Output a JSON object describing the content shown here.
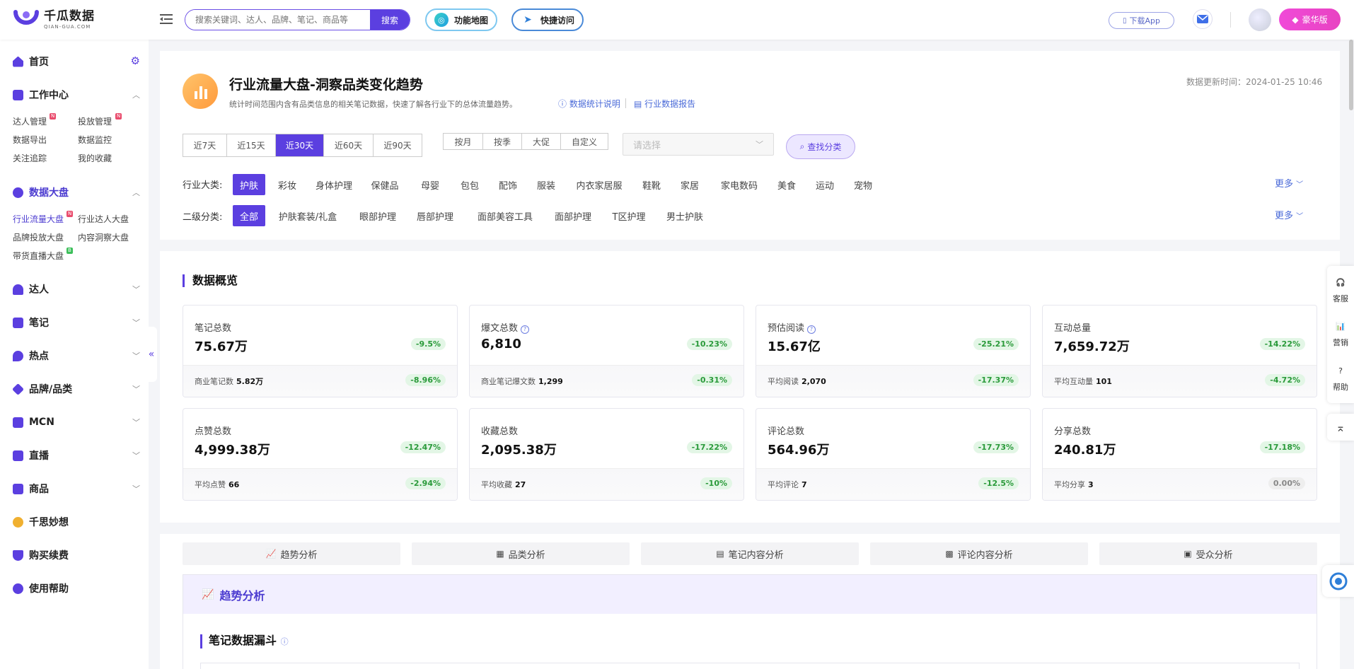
{
  "brand": {
    "name_cn": "千瓜数据",
    "name_en": "QIAN-GUA.COM",
    "accent": "#5b3fe0",
    "up_color": "#2a9a3a"
  },
  "header": {
    "search_placeholder": "搜索关键词、达人、品牌、笔记、商品等",
    "search_btn": "搜索",
    "feature_map": "功能地图",
    "quick_access": "快捷访问",
    "download_app": "下载App",
    "vip": "豪华版"
  },
  "sidebar": {
    "home": "首页",
    "workcenter": "工作中心",
    "work_items": [
      "达人管理",
      "投放管理",
      "数据导出",
      "数据监控",
      "关注追踪",
      "我的收藏"
    ],
    "databoard": "数据大盘",
    "board_items": [
      "行业流量大盘",
      "行业达人大盘",
      "品牌投放大盘",
      "内容洞察大盘",
      "带货直播大盘"
    ],
    "badge_new": "N",
    "badge_b": "B",
    "menus": [
      "达人",
      "笔记",
      "热点",
      "品牌/品类",
      "MCN",
      "直播",
      "商品",
      "千思妙想",
      "购买续费",
      "使用帮助"
    ]
  },
  "page": {
    "title": "行业流量大盘-洞察品类变化趋势",
    "subtitle": "统计时间范围内含有品类信息的相关笔记数据，快速了解各行业下的总体流量趋势。",
    "link_stats": "数据统计说明",
    "link_report": "行业数据报告",
    "update_time": "数据更新时间：2024-01-25 10:46"
  },
  "filters": {
    "ranges": [
      "近7天",
      "近15天",
      "近30天",
      "近60天",
      "近90天"
    ],
    "range_selected": "近30天",
    "periods": [
      "按月",
      "按季",
      "大促",
      "自定义"
    ],
    "select_placeholder": "请选择",
    "find_btn": "查找分类",
    "industry_label": "行业大类:",
    "industries": [
      "护肤",
      "彩妆",
      "身体护理",
      "保健品",
      "母婴",
      "包包",
      "配饰",
      "服装",
      "内衣家居服",
      "鞋靴",
      "家居",
      "家电数码",
      "美食",
      "运动",
      "宠物"
    ],
    "industry_selected": "护肤",
    "sub_label": "二级分类:",
    "subcats": [
      "全部",
      "护肤套装/礼盒",
      "眼部护理",
      "唇部护理",
      "面部美容工具",
      "面部护理",
      "T区护理",
      "男士护肤"
    ],
    "sub_selected": "全部",
    "more": "更多"
  },
  "overview": {
    "title": "数据概览",
    "stats": [
      {
        "label": "笔记总数",
        "value": "75.67万",
        "change": "-9.5%",
        "sub_label": "商业笔记数",
        "sub_value": "5.82万",
        "sub_change": "-8.96%",
        "help": false
      },
      {
        "label": "爆文总数",
        "value": "6,810",
        "change": "-10.23%",
        "sub_label": "商业笔记爆文数",
        "sub_value": "1,299",
        "sub_change": "-0.31%",
        "help": true
      },
      {
        "label": "预估阅读",
        "value": "15.67亿",
        "change": "-25.21%",
        "sub_label": "平均阅读",
        "sub_value": "2,070",
        "sub_change": "-17.37%",
        "help": true
      },
      {
        "label": "互动总量",
        "value": "7,659.72万",
        "change": "-14.22%",
        "sub_label": "平均互动量",
        "sub_value": "101",
        "sub_change": "-4.72%",
        "help": false
      },
      {
        "label": "点赞总数",
        "value": "4,999.38万",
        "change": "-12.47%",
        "sub_label": "平均点赞",
        "sub_value": "66",
        "sub_change": "-2.94%",
        "help": false
      },
      {
        "label": "收藏总数",
        "value": "2,095.38万",
        "change": "-17.22%",
        "sub_label": "平均收藏",
        "sub_value": "27",
        "sub_change": "-10%",
        "help": false
      },
      {
        "label": "评论总数",
        "value": "564.96万",
        "change": "-17.73%",
        "sub_label": "平均评论",
        "sub_value": "7",
        "sub_change": "-12.5%",
        "help": false
      },
      {
        "label": "分享总数",
        "value": "240.81万",
        "change": "-17.18%",
        "sub_label": "平均分享",
        "sub_value": "3",
        "sub_change": "0.00%",
        "help": false
      }
    ]
  },
  "analysis_tabs": [
    "趋势分析",
    "品类分析",
    "笔记内容分析",
    "评论内容分析",
    "受众分析"
  ],
  "trend": {
    "title": "趋势分析",
    "funnel_title": "笔记数据漏斗"
  },
  "float": {
    "service": "客服",
    "marketing": "营销",
    "help": "帮助"
  }
}
